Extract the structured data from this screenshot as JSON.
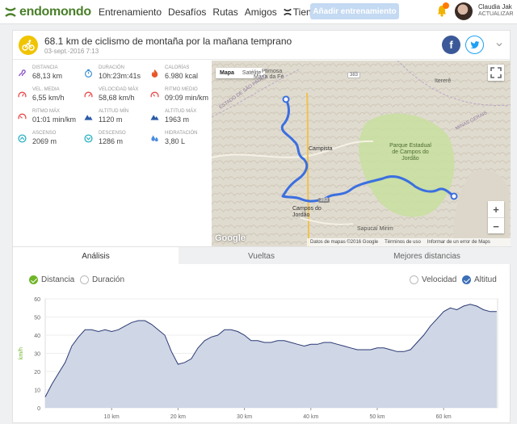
{
  "brand": {
    "name": "endomondo",
    "color": "#4a7f2a"
  },
  "nav": {
    "items": [
      "Entrenamiento",
      "Desafíos",
      "Rutas",
      "Amigos"
    ],
    "shop": "Tienda"
  },
  "add_button": "Añadir entrenamiento",
  "user": {
    "name": "Claudia Jak",
    "status": "ACTUALIZAR"
  },
  "workout": {
    "title": "68.1 km de ciclismo de montaña por la mañana temprano",
    "date": "03-sept.-2016 7:13",
    "sport_icon": "mountain-bike-icon"
  },
  "share": {
    "facebook": "f"
  },
  "stats": [
    {
      "label": "Distancia",
      "value": "68,13 km",
      "icon": "distance-icon",
      "color": "#8a4fc7"
    },
    {
      "label": "Duración",
      "value": "10h:23m:41s",
      "icon": "stopwatch-icon",
      "color": "#3b8fd6"
    },
    {
      "label": "Calorías",
      "value": "6.980 kcal",
      "icon": "flame-icon",
      "color": "#e8562a"
    },
    {
      "label": "Vel. media",
      "value": "6,55 km/h",
      "icon": "speedometer-icon",
      "color": "#e84a4a"
    },
    {
      "label": "Velocidad máx",
      "value": "58,68 km/h",
      "icon": "speedometer-icon",
      "color": "#e84a4a"
    },
    {
      "label": "Ritmo medio",
      "value": "09:09 min/km",
      "icon": "pace-icon",
      "color": "#e84a4a"
    },
    {
      "label": "Ritmo máx",
      "value": "01:01 min/km",
      "icon": "pace-icon",
      "color": "#e84a4a"
    },
    {
      "label": "Altitud mín",
      "value": "1120 m",
      "icon": "mountain-icon",
      "color": "#2a5ba8"
    },
    {
      "label": "Altitud máx",
      "value": "1963 m",
      "icon": "mountain-icon",
      "color": "#2a5ba8"
    },
    {
      "label": "Ascenso",
      "value": "2069 m",
      "icon": "ascent-icon",
      "color": "#2ab0c2"
    },
    {
      "label": "Descenso",
      "value": "1286 m",
      "icon": "descent-icon",
      "color": "#2ab0c2"
    },
    {
      "label": "Hidratación",
      "value": "3,80 L",
      "icon": "water-drop-icon",
      "color": "#4a8de0"
    }
  ],
  "map": {
    "type_active": "Mapa",
    "type_inactive": "Satélite",
    "labels": [
      "Maria da Fé",
      "Ptimosa",
      "Itererê",
      "Campista",
      "Parque Estadual de Campos do Jordão",
      "Campos do Jordão",
      "Sapucaí Mirim",
      "SP",
      "MINAS GERAIS",
      "ESTADO DE SÃO PAULO"
    ],
    "roads": [
      "383",
      "383"
    ],
    "google": "Google",
    "attribution": [
      "Datos de mapas ©2016 Google",
      "Términos de uso",
      "Informar de un error de Maps"
    ],
    "route_color": "#3b6fe0"
  },
  "tabs": [
    "Análisis",
    "Vueltas",
    "Mejores distancias"
  ],
  "chart_toggles": {
    "x_options": [
      "Distancia",
      "Duración"
    ],
    "y_options": [
      "Velocidad",
      "Altitud"
    ]
  },
  "chart_data": {
    "type": "area",
    "xlabel": "",
    "ylabel": "km/h",
    "ylim": [
      0,
      60
    ],
    "xlim": [
      0,
      68.13
    ],
    "yticks": [
      0,
      10,
      20,
      30,
      40,
      50,
      60
    ],
    "xticks": [
      "10 km",
      "20 km",
      "30 km",
      "40 km",
      "50 km",
      "60 km"
    ],
    "xtick_values": [
      10,
      20,
      30,
      40,
      50,
      60
    ],
    "series": [
      {
        "name": "",
        "x": [
          0,
          1,
          2,
          3,
          4,
          5,
          6,
          7,
          8,
          9,
          10,
          11,
          12,
          13,
          14,
          15,
          16,
          17,
          18,
          19,
          20,
          21,
          22,
          23,
          24,
          25,
          26,
          27,
          28,
          29,
          30,
          31,
          32,
          33,
          34,
          35,
          36,
          37,
          38,
          39,
          40,
          41,
          42,
          43,
          44,
          45,
          46,
          47,
          48,
          49,
          50,
          51,
          52,
          53,
          54,
          55,
          56,
          57,
          58,
          59,
          60,
          61,
          62,
          63,
          64,
          65,
          66,
          67,
          68
        ],
        "values": [
          6,
          13,
          19,
          25,
          34,
          39,
          43,
          43,
          42,
          43,
          42,
          43,
          45,
          47,
          48,
          48,
          46,
          43,
          40,
          31,
          24,
          25,
          27,
          33,
          37,
          39,
          40,
          43,
          43,
          42,
          40,
          37,
          37,
          36,
          36,
          37,
          37,
          36,
          35,
          34,
          35,
          35,
          36,
          36,
          35,
          34,
          33,
          32,
          32,
          32,
          33,
          33,
          32,
          31,
          31,
          32,
          36,
          40,
          45,
          49,
          53,
          55,
          54,
          56,
          57,
          56,
          54,
          53,
          53
        ]
      }
    ],
    "grid": true,
    "fill_color": "#cfd6e6",
    "line_color": "#2a3a73"
  }
}
